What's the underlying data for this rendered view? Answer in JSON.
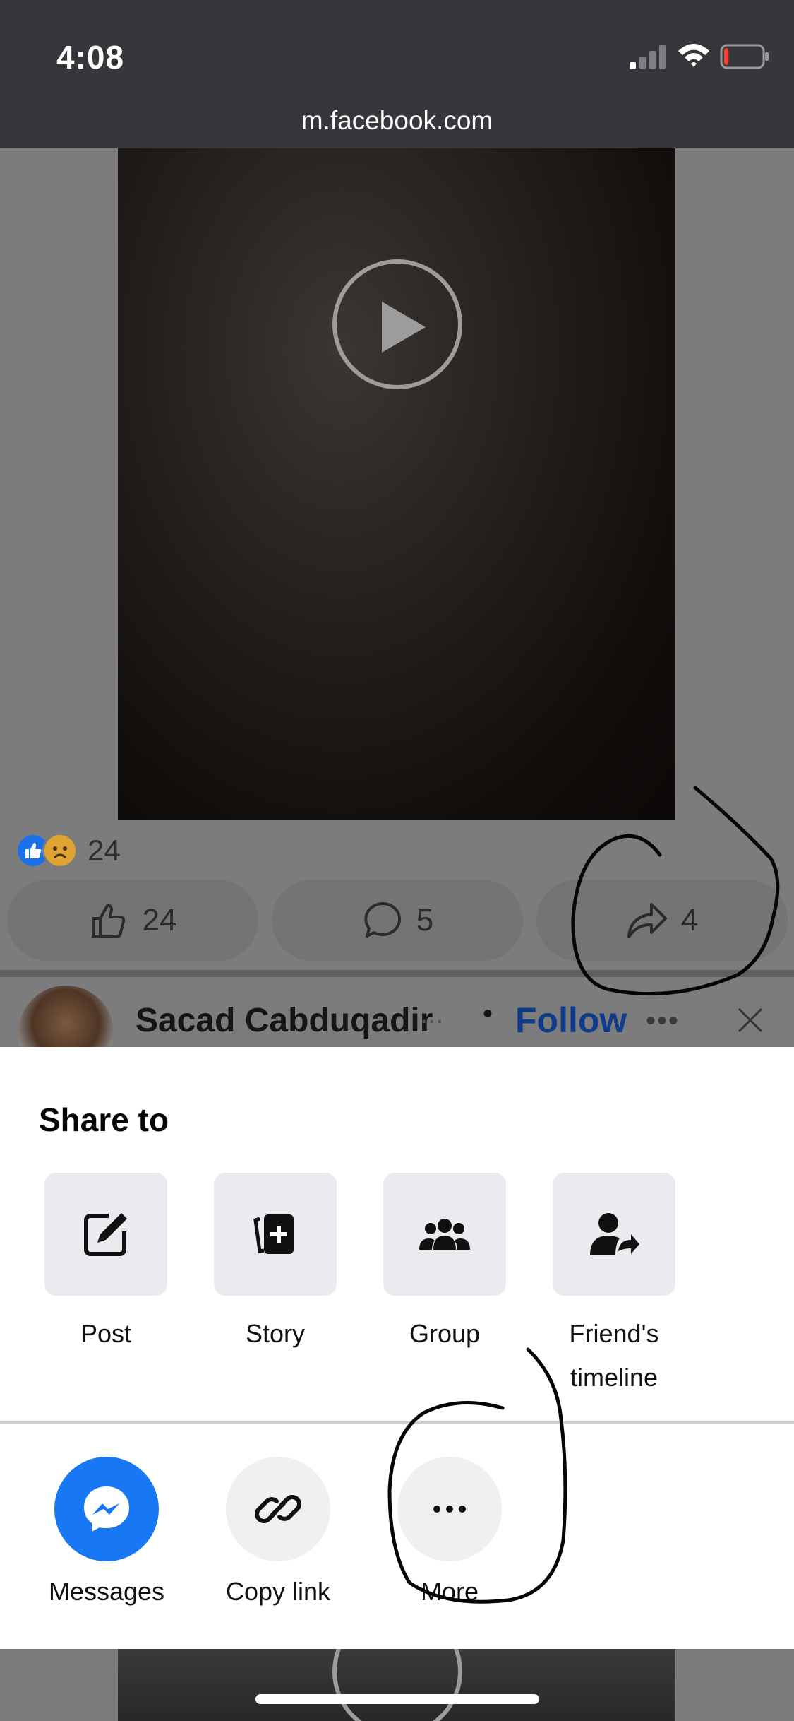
{
  "status_bar": {
    "time": "4:08",
    "battery_level": 0.12,
    "url": "m.facebook.com"
  },
  "video": {
    "play_icon": "play-icon"
  },
  "post": {
    "reaction_count": "24",
    "like_count": "24",
    "comment_count": "5",
    "share_count": "4",
    "author_name": "Sacad Cabduqadir",
    "author_ellipsis": "...",
    "separator": "•",
    "follow_label": "Follow",
    "more_label": "•••"
  },
  "share_sheet": {
    "title": "Share to",
    "targets": [
      {
        "label": "Post",
        "icon": "edit-icon"
      },
      {
        "label": "Story",
        "icon": "story-add-icon"
      },
      {
        "label": "Group",
        "icon": "group-icon"
      },
      {
        "label": "Friend's timeline",
        "icon": "friend-share-icon"
      }
    ],
    "actions": [
      {
        "label": "Messages",
        "icon": "messenger-icon"
      },
      {
        "label": "Copy link",
        "icon": "link-icon"
      },
      {
        "label": "More",
        "icon": "more-icon"
      }
    ]
  },
  "colors": {
    "status_bar": "#35373b",
    "overlay": "#7c7c7c",
    "facebook_blue": "#1877f2",
    "follow_blue": "#0e3b8a",
    "tile_bg": "#eaebee"
  }
}
